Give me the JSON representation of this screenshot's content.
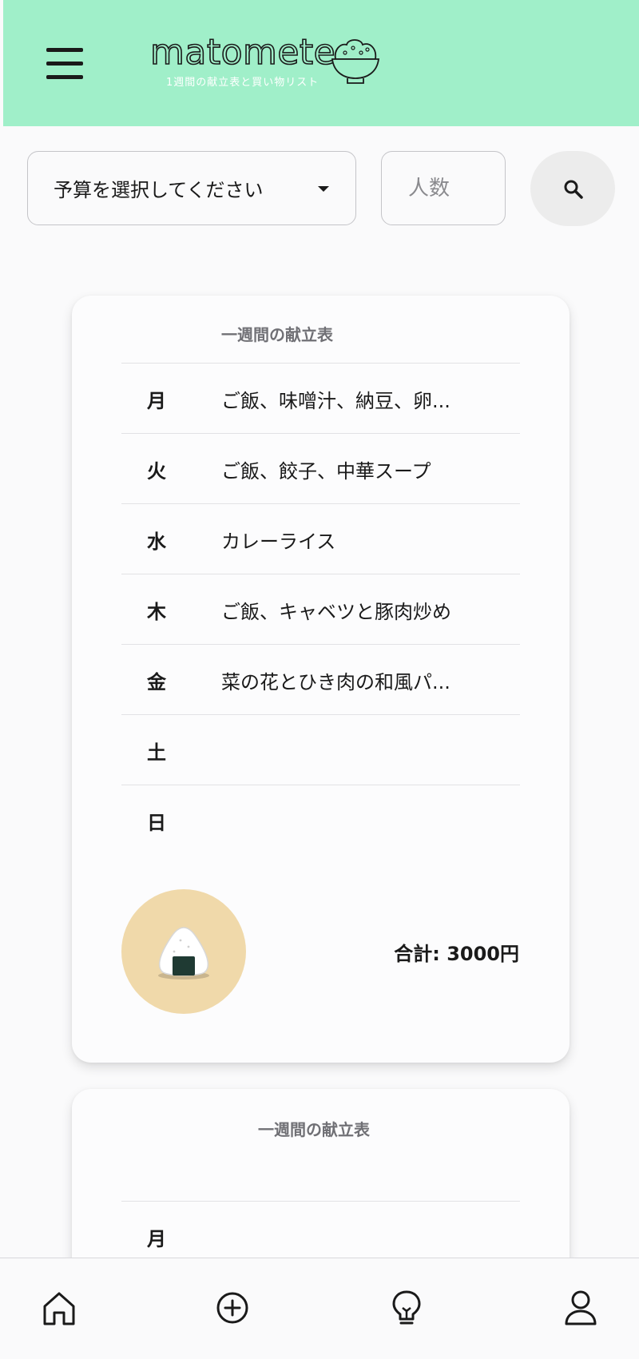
{
  "header": {
    "logo_text": "matomete",
    "tagline": "1週間の献立表と買い物リスト",
    "menu_icon": "hamburger-menu-icon",
    "logo_icon": "rice-bowl-icon",
    "background_color": "#a0efc9"
  },
  "filters": {
    "budget_select_label": "予算を選択してください",
    "people_placeholder": "人数",
    "search_icon": "search-icon"
  },
  "cards": [
    {
      "title": "一週間の献立表",
      "rows": [
        {
          "day": "月",
          "meal": "ご飯、味噌汁、納豆、卵..."
        },
        {
          "day": "火",
          "meal": "ご飯、餃子、中華スープ"
        },
        {
          "day": "水",
          "meal": "カレーライス"
        },
        {
          "day": "木",
          "meal": "ご飯、キャベツと豚肉炒め"
        },
        {
          "day": "金",
          "meal": "菜の花とひき肉の和風パ..."
        },
        {
          "day": "土",
          "meal": ""
        },
        {
          "day": "日",
          "meal": ""
        }
      ],
      "image_icon": "onigiri-icon",
      "total": "合計: 3000円"
    },
    {
      "title": "一週間の献立表",
      "rows": [
        {
          "day": "月",
          "meal": ""
        }
      ]
    }
  ],
  "bottom_nav": {
    "items": [
      {
        "name": "home",
        "icon": "home-icon"
      },
      {
        "name": "add",
        "icon": "plus-circle-icon"
      },
      {
        "name": "tips",
        "icon": "lightbulb-icon"
      },
      {
        "name": "profile",
        "icon": "user-icon"
      }
    ]
  },
  "colors": {
    "accent": "#a0efc9",
    "onigiri_bg": "#f0d9aa",
    "search_bg": "#ececec"
  }
}
